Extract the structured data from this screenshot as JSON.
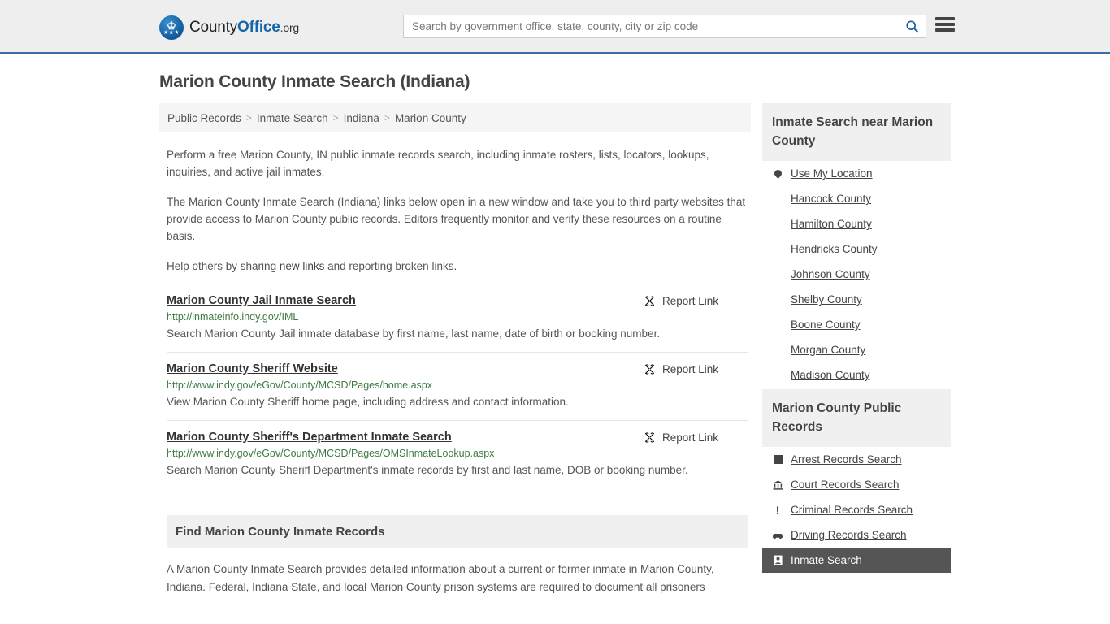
{
  "header": {
    "logo": {
      "name_part1": "County",
      "name_part2": "Office",
      "tld": ".org",
      "eagle_icon": "eagle-icon",
      "stars": "★★★"
    },
    "search": {
      "placeholder": "Search by government office, state, county, city or zip code",
      "value": "",
      "search_icon": "search-icon"
    },
    "menu_icon": "hamburger-menu-icon",
    "accent_color": "#3a6ea5",
    "background_color": "#eeeeee"
  },
  "page": {
    "title": "Marion County Inmate Search (Indiana)"
  },
  "breadcrumb": {
    "separator": ">",
    "items": [
      {
        "label": "Public Records"
      },
      {
        "label": "Inmate Search"
      },
      {
        "label": "Indiana"
      },
      {
        "label": "Marion County"
      }
    ]
  },
  "intro": {
    "p1": "Perform a free Marion County, IN public inmate records search, including inmate rosters, lists, locators, lookups, inquiries, and active jail inmates.",
    "p2": "The Marion County Inmate Search (Indiana) links below open in a new window and take you to third party websites that provide access to Marion County public records. Editors frequently monitor and verify these resources on a routine basis.",
    "p3_before": "Help others by sharing ",
    "p3_link": "new links",
    "p3_after": " and reporting broken links."
  },
  "links": {
    "report_label": "Report Link",
    "report_icon": "broken-link-icon",
    "entries": [
      {
        "title": "Marion County Jail Inmate Search",
        "url": "http://inmateinfo.indy.gov/IML",
        "description": "Search Marion County Jail inmate database by first name, last name, date of birth or booking number."
      },
      {
        "title": "Marion County Sheriff Website",
        "url": "http://www.indy.gov/eGov/County/MCSD/Pages/home.aspx",
        "description": "View Marion County Sheriff home page, including address and contact information."
      },
      {
        "title": "Marion County Sheriff's Department Inmate Search",
        "url": "http://www.indy.gov/eGov/County/MCSD/Pages/OMSInmateLookup.aspx",
        "description": "Search Marion County Sheriff Department's inmate records by first and last name, DOB or booking number."
      }
    ]
  },
  "find_section": {
    "heading": "Find Marion County Inmate Records",
    "body": "A Marion County Inmate Search provides detailed information about a current or former inmate in Marion County, Indiana. Federal, Indiana State, and local Marion County prison systems are required to document all prisoners"
  },
  "sidebar": {
    "nearby": {
      "heading": "Inmate Search near Marion County",
      "items": [
        {
          "label": "Use My Location",
          "icon": "map-pin-icon",
          "highlighted": false
        },
        {
          "label": "Hancock County",
          "icon": "",
          "highlighted": false
        },
        {
          "label": "Hamilton County",
          "icon": "",
          "highlighted": false
        },
        {
          "label": "Hendricks County",
          "icon": "",
          "highlighted": false
        },
        {
          "label": "Johnson County",
          "icon": "",
          "highlighted": false
        },
        {
          "label": "Shelby County",
          "icon": "",
          "highlighted": false
        },
        {
          "label": "Boone County",
          "icon": "",
          "highlighted": false
        },
        {
          "label": "Morgan County",
          "icon": "",
          "highlighted": false
        },
        {
          "label": "Madison County",
          "icon": "",
          "highlighted": false
        }
      ]
    },
    "public_records": {
      "heading": "Marion County Public Records",
      "items": [
        {
          "label": "Arrest Records Search",
          "icon": "fingerprint-card-icon",
          "highlighted": false
        },
        {
          "label": "Court Records Search",
          "icon": "courthouse-icon",
          "highlighted": false
        },
        {
          "label": "Criminal Records Search",
          "icon": "exclamation-icon",
          "highlighted": false
        },
        {
          "label": "Driving Records Search",
          "icon": "car-icon",
          "highlighted": false
        },
        {
          "label": "Inmate Search",
          "icon": "id-card-icon",
          "highlighted": true
        }
      ],
      "highlight_color": "#555555"
    }
  }
}
